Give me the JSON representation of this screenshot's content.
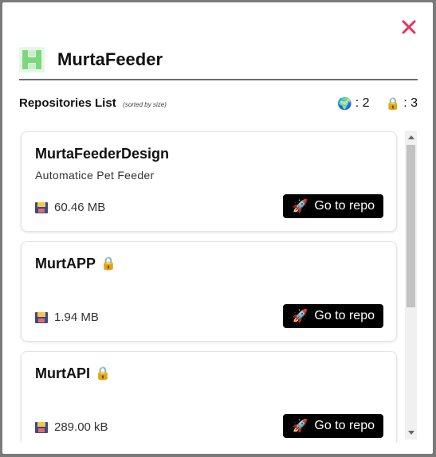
{
  "app": {
    "title": "MurtaFeeder"
  },
  "list": {
    "title": "Repositories List",
    "subtitle": "(sorted by size)",
    "public_count_label": ": 2",
    "private_count_label": ": 3",
    "public_icon": "globe-icon",
    "private_icon": "lock-icon"
  },
  "repos": [
    {
      "name": "MurtaFeederDesign",
      "description": "Automatice Pet Feeder",
      "size": "60.46 MB",
      "private": false,
      "button_label": "Go to repo"
    },
    {
      "name": "MurtAPP",
      "description": "",
      "size": "1.94 MB",
      "private": true,
      "button_label": "Go to repo"
    },
    {
      "name": "MurtAPI",
      "description": "",
      "size": "289.00 kB",
      "private": true,
      "button_label": "Go to repo"
    }
  ],
  "colors": {
    "close": "#e8345c",
    "logo": "#7dd87d",
    "button_bg": "#000000",
    "button_text": "#ffffff"
  }
}
